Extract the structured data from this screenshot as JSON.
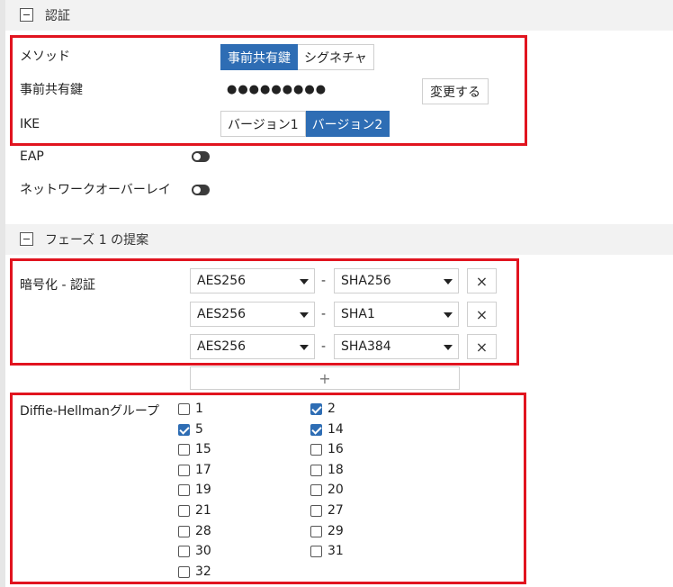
{
  "colors": {
    "accent": "#2e6db4",
    "highlight": "#e1141f"
  },
  "auth_section": {
    "title": "認証",
    "method": {
      "label": "メソッド",
      "options": [
        "事前共有鍵",
        "シグネチャ"
      ],
      "selected": "事前共有鍵"
    },
    "psk": {
      "label": "事前共有鍵",
      "masked_value": "●●●●●●●●●",
      "change_button": "変更する"
    },
    "ike": {
      "label": "IKE",
      "options": [
        "バージョン1",
        "バージョン2"
      ],
      "selected": "バージョン2"
    },
    "eap": {
      "label": "EAP",
      "enabled": false
    },
    "overlay": {
      "label": "ネットワークオーバーレイ",
      "enabled": false
    }
  },
  "phase1_section": {
    "title": "フェーズ 1 の提案",
    "encryption": {
      "label": "暗号化 - 認証",
      "separator": "-",
      "rows": [
        {
          "encryption": "AES256",
          "auth": "SHA256"
        },
        {
          "encryption": "AES256",
          "auth": "SHA1"
        },
        {
          "encryption": "AES256",
          "auth": "SHA384"
        }
      ],
      "remove_symbol": "×",
      "add_symbol": "+"
    },
    "dh": {
      "label": "Diffie-Hellmanグループ",
      "groups": [
        {
          "value": "1",
          "checked": false
        },
        {
          "value": "2",
          "checked": true
        },
        {
          "value": "5",
          "checked": true
        },
        {
          "value": "14",
          "checked": true
        },
        {
          "value": "15",
          "checked": false
        },
        {
          "value": "16",
          "checked": false
        },
        {
          "value": "17",
          "checked": false
        },
        {
          "value": "18",
          "checked": false
        },
        {
          "value": "19",
          "checked": false
        },
        {
          "value": "20",
          "checked": false
        },
        {
          "value": "21",
          "checked": false
        },
        {
          "value": "27",
          "checked": false
        },
        {
          "value": "28",
          "checked": false
        },
        {
          "value": "29",
          "checked": false
        },
        {
          "value": "30",
          "checked": false
        },
        {
          "value": "31",
          "checked": false
        },
        {
          "value": "32",
          "checked": false
        }
      ]
    }
  }
}
